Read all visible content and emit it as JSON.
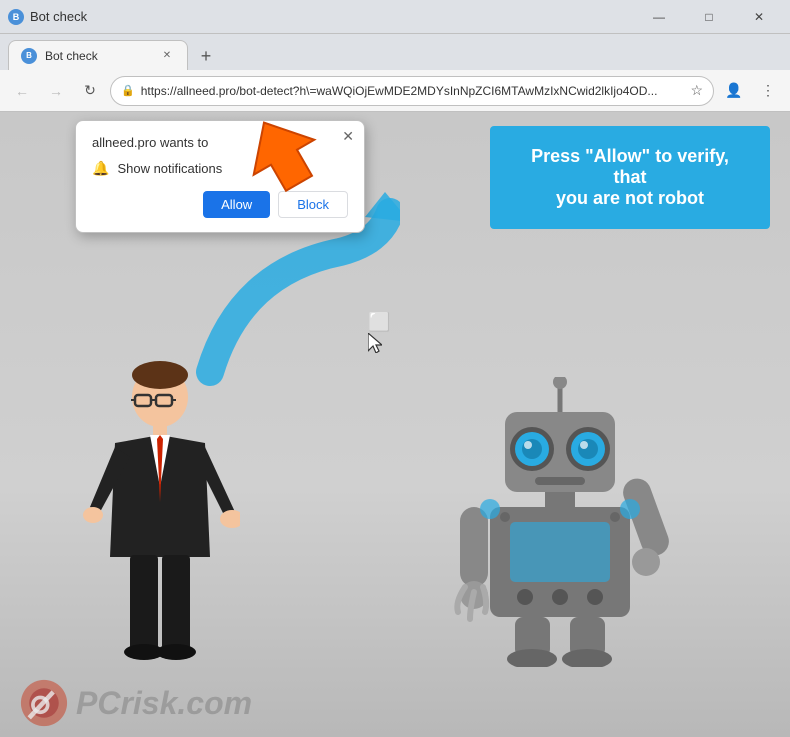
{
  "titlebar": {
    "title": "Bot check",
    "favicon": "B",
    "controls": {
      "minimize": "—",
      "maximize": "□",
      "close": "✕"
    }
  },
  "tabs": {
    "active_label": "Bot check",
    "new_tab": "+"
  },
  "addressbar": {
    "url": "https://allneed.pro/bot-detect?h\\=waWQiOjEwMDE2MDYsInNpZCI6MTAwMzIxNCwid2lkIjo4OD...",
    "back": "←",
    "forward": "→",
    "refresh": "↻",
    "star": "☆",
    "account": "👤",
    "menu": "⋮"
  },
  "popup": {
    "title": "allneed.pro wants to",
    "show_notifications": "Show notifications",
    "allow_label": "Allow",
    "block_label": "Block",
    "close": "✕"
  },
  "page": {
    "press_allow_line1": "Press \"Allow\" to verify, that",
    "press_allow_line2": "you are not robot"
  },
  "watermark": {
    "text": "PCrisk.com"
  },
  "colors": {
    "allow_btn": "#1a73e8",
    "press_allow_bg": "#29abe2",
    "orange_arrow": "#ff6600",
    "blue_arrow": "#29abe2"
  }
}
